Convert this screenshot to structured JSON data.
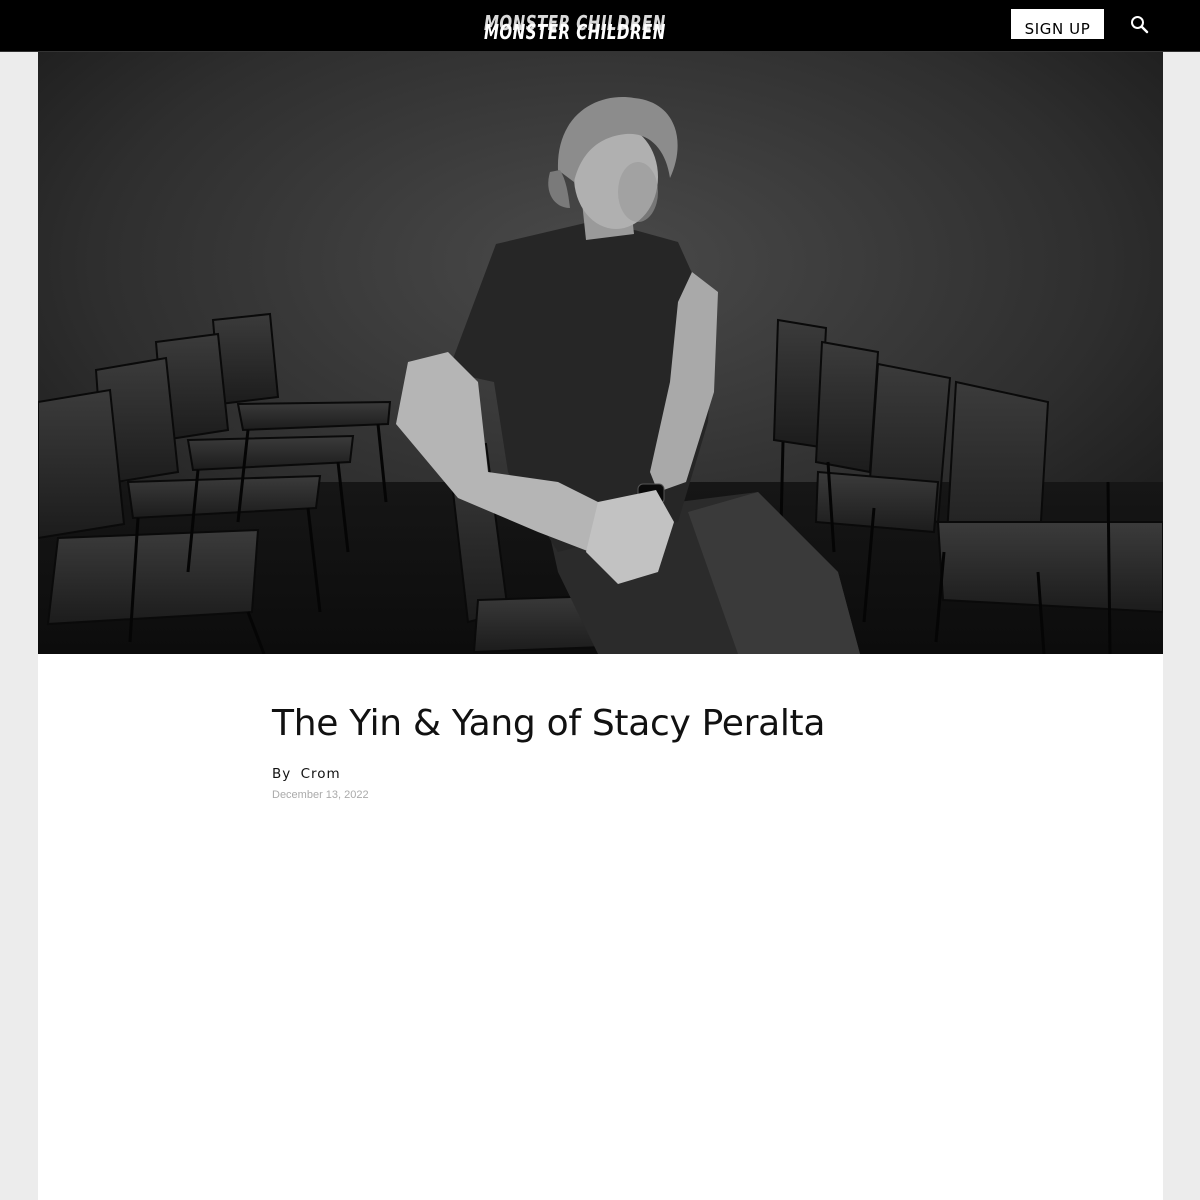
{
  "header": {
    "logo_text": "MONSTER CHILDREN",
    "signup_label": "SIGN UP",
    "search_icon": "search-icon"
  },
  "hero": {
    "image": "black-and-white portrait photo",
    "alt": "Stacy Peralta"
  },
  "article": {
    "title": "The Yin & Yang of Stacy Peralta",
    "by_label": "By",
    "author": "Crom",
    "date": "December 13, 2022"
  }
}
